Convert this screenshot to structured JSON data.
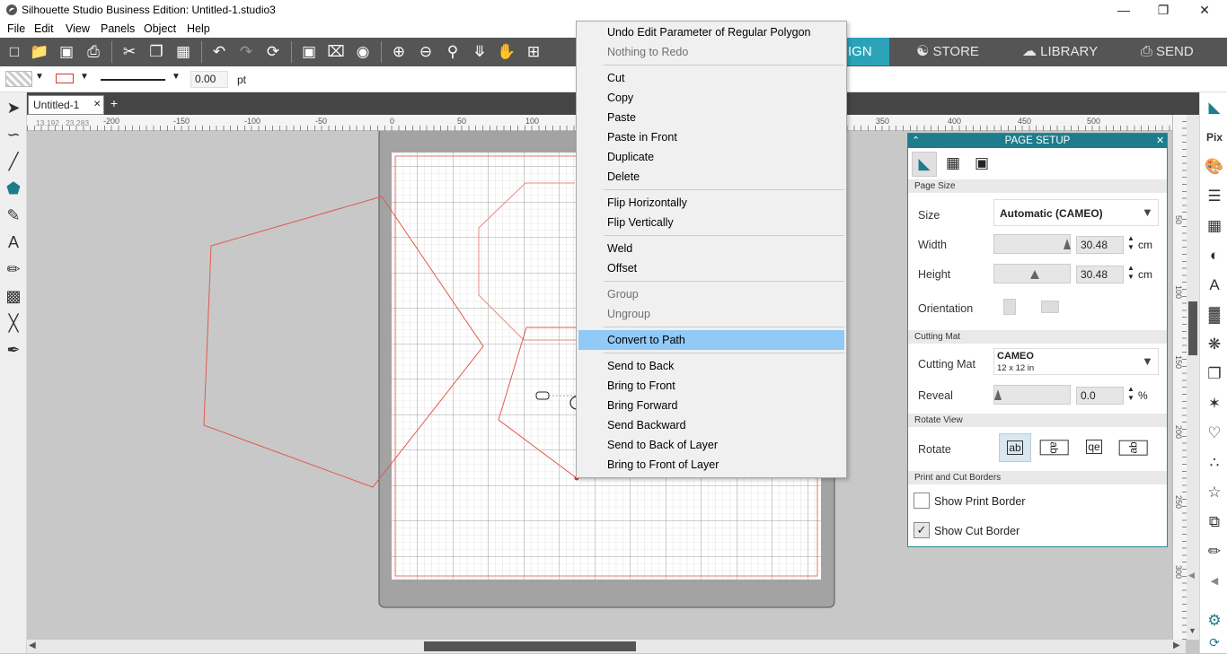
{
  "window": {
    "title": "Silhouette Studio Business Edition: Untitled-1.studio3",
    "minimize": "—",
    "restore": "❐",
    "close": "✕"
  },
  "menubar": [
    "File",
    "Edit",
    "View",
    "Panels",
    "Object",
    "Help"
  ],
  "nav_tabs": {
    "design_partial": "IGN",
    "store": "STORE",
    "library": "LIBRARY",
    "send": "SEND"
  },
  "options_bar": {
    "line_width": "0.00",
    "line_unit": "pt"
  },
  "doc_tab": {
    "name": "Untitled-1",
    "close": "✕",
    "add": "+"
  },
  "ruler": {
    "cursor_readout": "13.192 , 23.283",
    "h_ticks": [
      "-200",
      "-150",
      "-100",
      "-50",
      "0",
      "50",
      "100",
      "350",
      "400",
      "450",
      "500"
    ],
    "v_ticks": [
      "50",
      "100",
      "150",
      "200",
      "250",
      "300"
    ]
  },
  "context_menu": {
    "items": [
      {
        "label": "Undo Edit Parameter of Regular Polygon",
        "enabled": true
      },
      {
        "label": "Nothing to Redo",
        "enabled": false
      },
      {
        "label": "Cut",
        "enabled": true
      },
      {
        "label": "Copy",
        "enabled": true
      },
      {
        "label": "Paste",
        "enabled": true
      },
      {
        "label": "Paste in Front",
        "enabled": true
      },
      {
        "label": "Duplicate",
        "enabled": true
      },
      {
        "label": "Delete",
        "enabled": true
      },
      {
        "label": "Flip Horizontally",
        "enabled": true
      },
      {
        "label": "Flip Vertically",
        "enabled": true
      },
      {
        "label": "Weld",
        "enabled": true
      },
      {
        "label": "Offset",
        "enabled": true
      },
      {
        "label": "Group",
        "enabled": false
      },
      {
        "label": "Ungroup",
        "enabled": false
      },
      {
        "label": "Convert to Path",
        "enabled": true,
        "highlighted": true
      },
      {
        "label": "Send to Back",
        "enabled": true
      },
      {
        "label": "Bring to Front",
        "enabled": true
      },
      {
        "label": "Bring Forward",
        "enabled": true
      },
      {
        "label": "Send Backward",
        "enabled": true
      },
      {
        "label": "Send to Back of Layer",
        "enabled": true
      },
      {
        "label": "Bring to Front of Layer",
        "enabled": true
      }
    ]
  },
  "page_setup": {
    "title": "PAGE SETUP",
    "sections": {
      "page_size": "Page Size",
      "cutting_mat": "Cutting Mat",
      "rotate_view": "Rotate View",
      "borders": "Print and Cut Borders"
    },
    "size_label": "Size",
    "size_value": "Automatic (CAMEO)",
    "width_label": "Width",
    "width_value": "30.48",
    "width_unit": "cm",
    "height_label": "Height",
    "height_value": "30.48",
    "height_unit": "cm",
    "orientation_label": "Orientation",
    "cutting_mat_label": "Cutting Mat",
    "cutting_mat_value": "CAMEO",
    "cutting_mat_sub": "12 x 12 in",
    "reveal_label": "Reveal",
    "reveal_value": "0.0",
    "reveal_unit": "%",
    "rotate_label": "Rotate",
    "rotate_options": [
      "ab",
      "ab",
      "qe",
      "ab"
    ],
    "show_print_border": "Show Print Border",
    "show_cut_border": "Show Cut Border",
    "show_print_border_checked": false,
    "show_cut_border_checked": true
  },
  "colors": {
    "accent": "#1e7c8c",
    "toolbar": "#555555",
    "menu_highlight": "#91c9f7",
    "shape_stroke": "#e05a4e",
    "active_nav": "#2aa3b8"
  }
}
